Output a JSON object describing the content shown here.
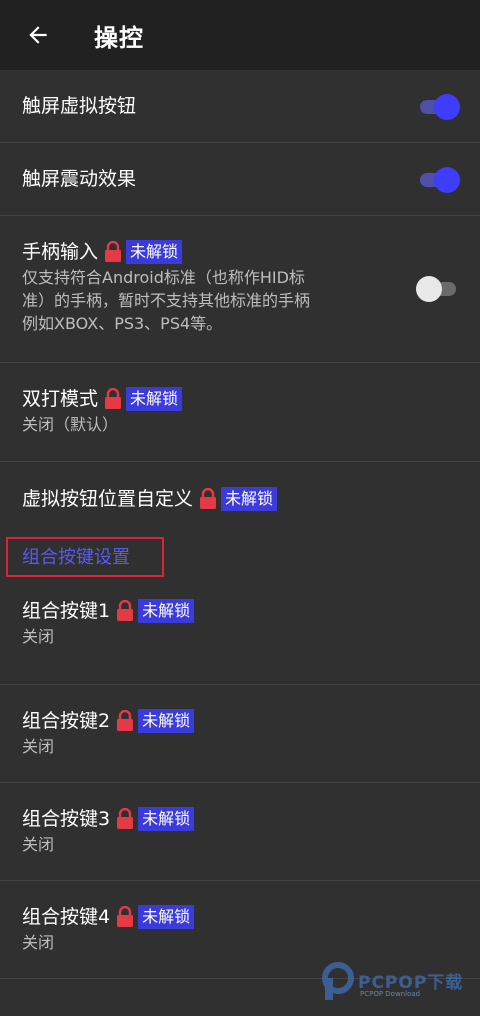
{
  "appbar": {
    "title": "操控"
  },
  "settings": [
    {
      "title": "触屏虚拟按钮",
      "switch": "on"
    },
    {
      "title": "触屏震动效果",
      "switch": "on"
    },
    {
      "title": "手柄输入",
      "badge": "未解锁",
      "sub_lines": [
        "仅支持符合Android标准（也称作HID标",
        "准）的手柄，暂时不支持其他标准的手柄",
        "例如XBOX、PS3、PS4等。"
      ],
      "switch": "off"
    },
    {
      "title": "双打模式",
      "badge": "未解锁",
      "sub": "关闭（默认）"
    },
    {
      "title": "虚拟按钮位置自定义",
      "badge": "未解锁"
    }
  ],
  "section": {
    "title": "组合按键设置"
  },
  "combo": [
    {
      "title": "组合按键1",
      "badge": "未解锁",
      "sub": "关闭"
    },
    {
      "title": "组合按键2",
      "badge": "未解锁",
      "sub": "关闭"
    },
    {
      "title": "组合按键3",
      "badge": "未解锁",
      "sub": "关闭"
    },
    {
      "title": "组合按键4",
      "badge": "未解锁",
      "sub": "关闭"
    }
  ],
  "watermark": {
    "name": "PCPOP下载",
    "sub": "PCPOP Download"
  },
  "colors": {
    "accent": "#3d3dfa",
    "badge": "#3b3bdc",
    "lock": "#e53945",
    "highlight_box": "#e0213a"
  }
}
